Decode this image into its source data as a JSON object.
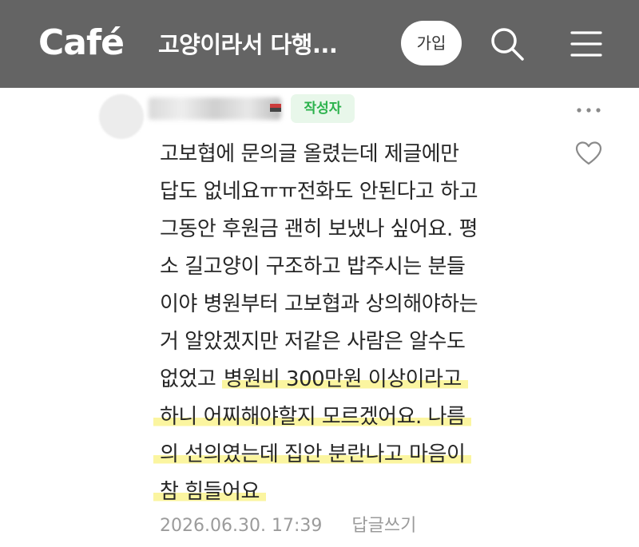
{
  "header": {
    "logo": "Café",
    "cafe_title": "고양이라서 다행...",
    "join_label": "가입",
    "background": "#646464"
  },
  "icons": {
    "search": "search-icon",
    "menu": "menu-icon",
    "more": "more-icon",
    "like": "heart-icon"
  },
  "comment": {
    "author_badge": "작성자",
    "badge_color": "#2bb24c",
    "lines": [
      "고보협에 문의글 올렸는데 제글에만",
      "답도 없네요ㅠㅠ전화도 안된다고 하고",
      "그동안 후원금 괜히 보냈나 싶어요. 평",
      "소 길고양이 구조하고 밥주시는 분들",
      "이야 병원부터 고보협과 상의해야하는",
      "거 알았겠지만 저같은 사람은 알수도"
    ],
    "line7_plain": "없었고 ",
    "line7_highlight": "병원비 300만원 이상이라고",
    "highlight_lines": [
      "하니 어찌해야할지 모르겠어요. 나름",
      "의 선의였는데 집안 분란나고 마음이",
      "참 힘들어요"
    ],
    "highlight_color": "#fbf5a0",
    "timestamp": "2026.06.30. 17:39",
    "reply_label": "답글쓰기"
  }
}
